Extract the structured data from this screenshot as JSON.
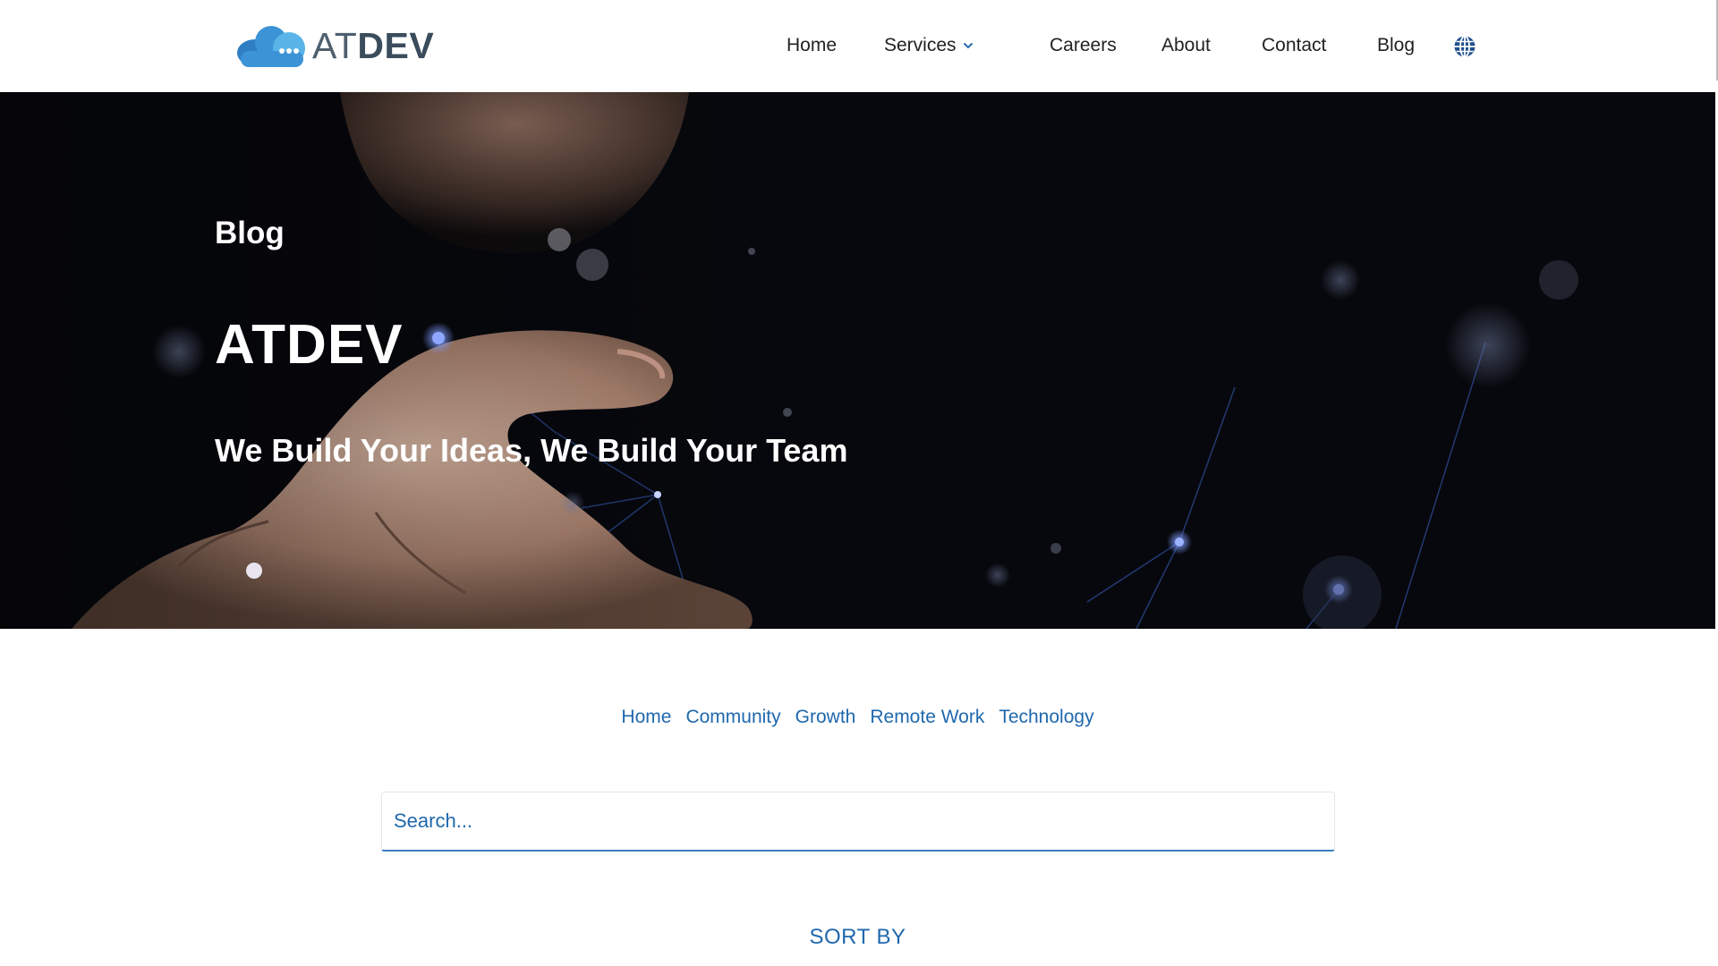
{
  "logo": {
    "at": "AT",
    "dev": "DEV"
  },
  "nav": {
    "items": [
      "Home",
      "Services",
      "Careers",
      "About",
      "Contact",
      "Blog"
    ],
    "services_has_dropdown": true
  },
  "icons": {
    "logo": "cloud-chat-icon",
    "dropdown": "chevron-down-icon",
    "language": "globe-icon"
  },
  "hero": {
    "label": "Blog",
    "title": "ATDEV",
    "tagline": "We Build Your Ideas, We Build Your Team"
  },
  "categories": [
    "Home",
    "Community",
    "Growth",
    "Remote Work",
    "Technology"
  ],
  "search": {
    "placeholder": "Search...",
    "value": ""
  },
  "sort": {
    "label": "SORT BY"
  },
  "colors": {
    "link": "#1f68ad",
    "logo_light_blue": "#5ab4e8",
    "logo_dark_blue": "#2f7ec4",
    "hero_bg": "#07080d"
  }
}
